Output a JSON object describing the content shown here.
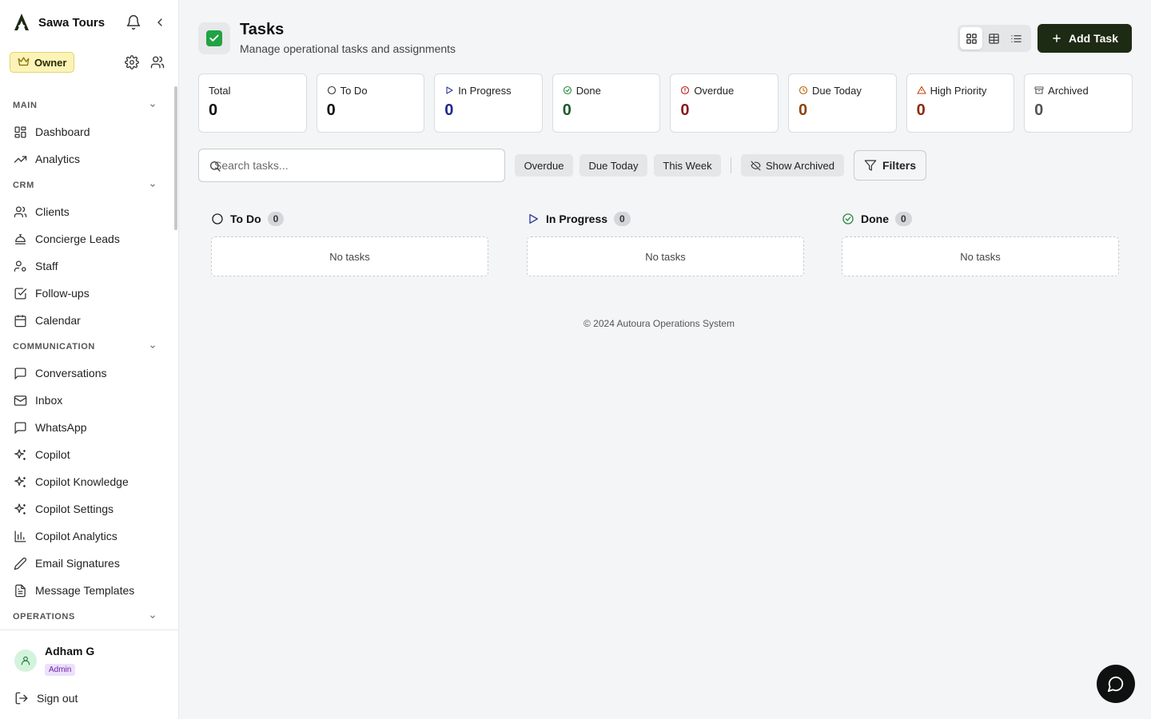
{
  "brand": {
    "name": "Sawa Tours"
  },
  "role_badge": "Owner",
  "nav": {
    "sections": [
      {
        "title": "MAIN",
        "items": [
          {
            "label": "Dashboard",
            "icon": "dashboard-icon"
          },
          {
            "label": "Analytics",
            "icon": "trend-icon"
          }
        ]
      },
      {
        "title": "CRM",
        "items": [
          {
            "label": "Clients",
            "icon": "users-icon"
          },
          {
            "label": "Concierge Leads",
            "icon": "bell-concierge-icon"
          },
          {
            "label": "Staff",
            "icon": "user-cog-icon"
          },
          {
            "label": "Follow-ups",
            "icon": "check-square-icon"
          },
          {
            "label": "Calendar",
            "icon": "calendar-icon"
          }
        ]
      },
      {
        "title": "COMMUNICATION",
        "items": [
          {
            "label": "Conversations",
            "icon": "message-square-icon"
          },
          {
            "label": "Inbox",
            "icon": "mail-icon"
          },
          {
            "label": "WhatsApp",
            "icon": "message-square-icon"
          },
          {
            "label": "Copilot",
            "icon": "sparkles-icon"
          },
          {
            "label": "Copilot Knowledge",
            "icon": "sparkles-icon"
          },
          {
            "label": "Copilot Settings",
            "icon": "sparkles-icon"
          },
          {
            "label": "Copilot Analytics",
            "icon": "bar-chart-icon"
          },
          {
            "label": "Email Signatures",
            "icon": "pen-icon"
          },
          {
            "label": "Message Templates",
            "icon": "file-text-icon"
          }
        ]
      },
      {
        "title": "OPERATIONS",
        "items": []
      }
    ]
  },
  "user": {
    "name": "Adham G",
    "role": "Admin",
    "signout_label": "Sign out"
  },
  "page": {
    "title": "Tasks",
    "subtitle": "Manage operational tasks and assignments",
    "add_label": "Add Task"
  },
  "stats": [
    {
      "label": "Total",
      "value": "0",
      "color": "#111111",
      "icon": ""
    },
    {
      "label": "To Do",
      "value": "0",
      "color": "#111111",
      "icon": "circle-icon"
    },
    {
      "label": "In Progress",
      "value": "0",
      "color": "#1e2a8a",
      "icon": "play-icon"
    },
    {
      "label": "Done",
      "value": "0",
      "color": "#1f5a2a",
      "icon": "check-circle-icon"
    },
    {
      "label": "Overdue",
      "value": "0",
      "color": "#8b1a1a",
      "icon": "alert-circle-icon"
    },
    {
      "label": "Due Today",
      "value": "0",
      "color": "#8b4513",
      "icon": "clock-icon"
    },
    {
      "label": "High Priority",
      "value": "0",
      "color": "#8b2a10",
      "icon": "alert-triangle-icon"
    },
    {
      "label": "Archived",
      "value": "0",
      "color": "#555555",
      "icon": "archive-icon"
    }
  ],
  "search": {
    "placeholder": "Search tasks..."
  },
  "chips": {
    "overdue": "Overdue",
    "due_today": "Due Today",
    "this_week": "This Week",
    "show_archived": "Show Archived"
  },
  "filters_label": "Filters",
  "columns": [
    {
      "title": "To Do",
      "count": "0",
      "empty": "No tasks"
    },
    {
      "title": "In Progress",
      "count": "0",
      "empty": "No tasks"
    },
    {
      "title": "Done",
      "count": "0",
      "empty": "No tasks"
    }
  ],
  "footer": "© 2024 Autoura Operations System",
  "colors": {
    "accent": "#1d2a14",
    "owner_badge": "#fbf3b8",
    "admin_badge": "#ede0fb"
  }
}
